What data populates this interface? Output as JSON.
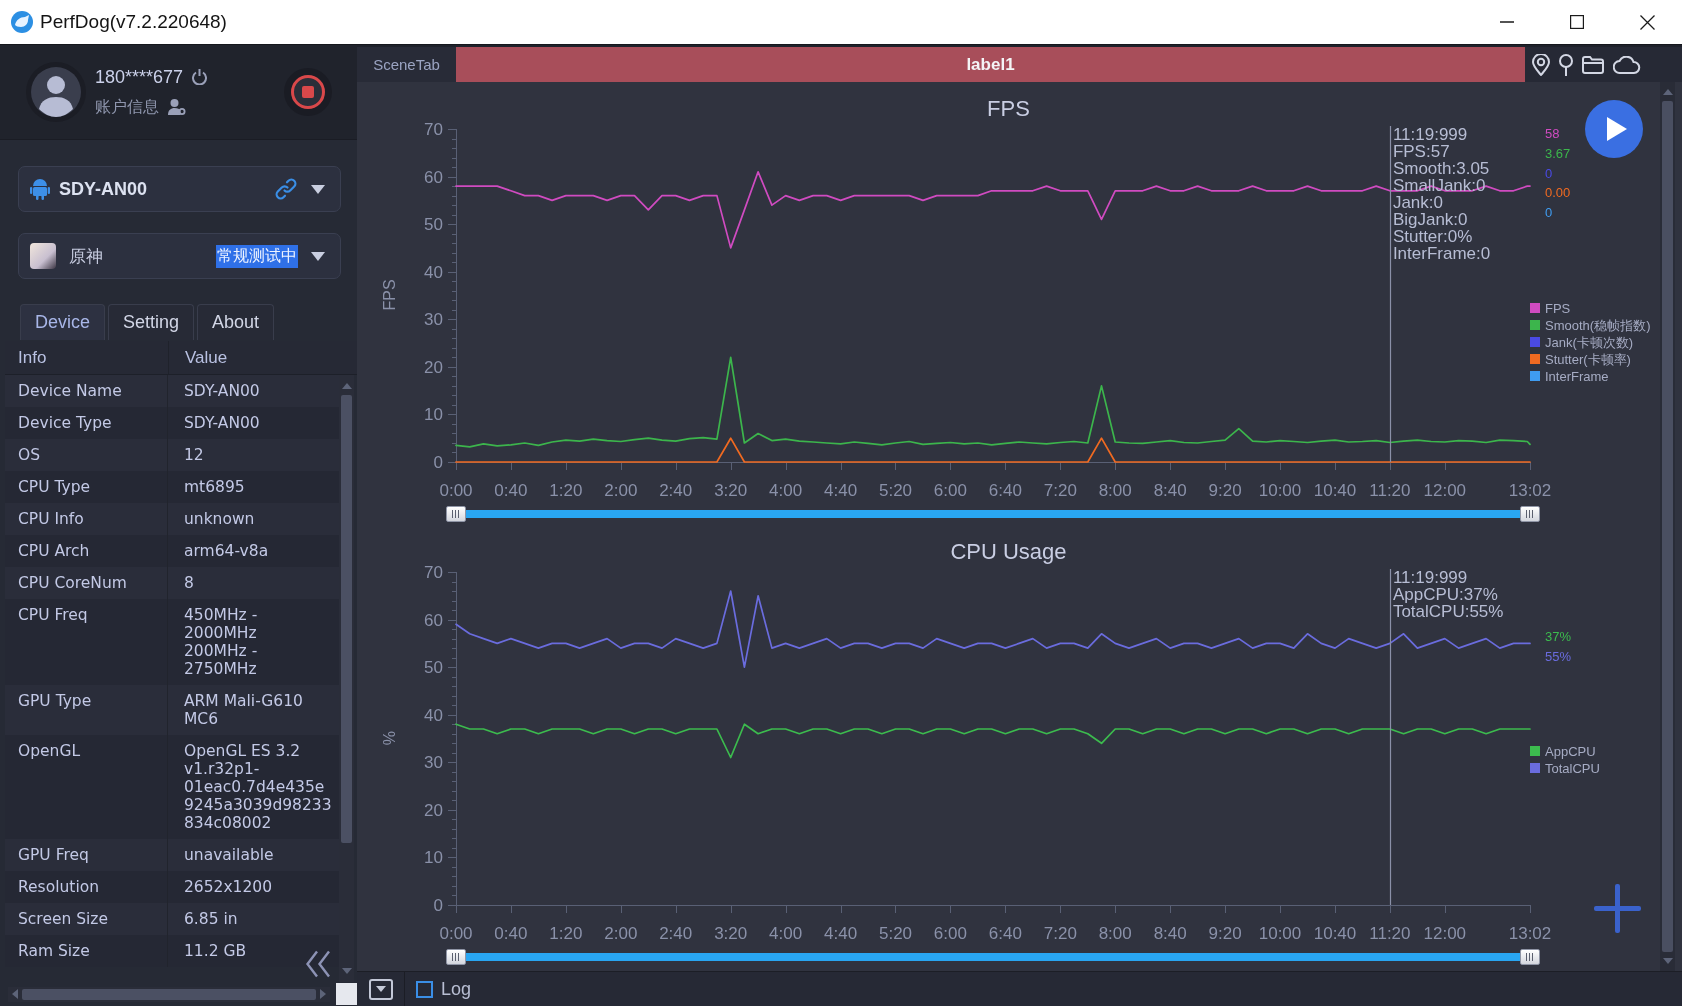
{
  "window": {
    "title": "PerfDog(v7.2.220648)"
  },
  "account": {
    "user": "180****677",
    "info_label": "账户信息",
    "recording": true
  },
  "device_selector": {
    "value": "SDY-AN00"
  },
  "app_selector": {
    "name": "原神",
    "status": "常规测试中",
    "status_highlighted": true
  },
  "tabs": [
    {
      "label": "Device",
      "selected": true
    },
    {
      "label": "Setting",
      "selected": false
    },
    {
      "label": "About",
      "selected": false
    }
  ],
  "info_table": {
    "columns": [
      "Info",
      "Value"
    ],
    "rows": [
      {
        "name": "Device Name",
        "values": [
          "SDY-AN00"
        ]
      },
      {
        "name": "Device Type",
        "values": [
          "SDY-AN00"
        ]
      },
      {
        "name": "OS",
        "values": [
          "12"
        ]
      },
      {
        "name": "CPU Type",
        "values": [
          "mt6895"
        ]
      },
      {
        "name": "CPU Info",
        "values": [
          "unknown"
        ]
      },
      {
        "name": "CPU Arch",
        "values": [
          "arm64-v8a"
        ]
      },
      {
        "name": "CPU CoreNum",
        "values": [
          "8"
        ]
      },
      {
        "name": "CPU Freq",
        "values": [
          "450MHz - 2000MHz",
          "200MHz - 2750MHz"
        ]
      },
      {
        "name": "GPU Type",
        "values": [
          "ARM Mali-G610 MC6"
        ]
      },
      {
        "name": "OpenGL",
        "values": [
          "OpenGL ES 3.2 v1.r32p1-01eac0.7d4e435e9245a3039d98233834c08002"
        ]
      },
      {
        "name": "GPU Freq",
        "values": [
          "unavailable"
        ]
      },
      {
        "name": "Resolution",
        "values": [
          "2652x1200"
        ]
      },
      {
        "name": "Screen Size",
        "values": [
          "6.85 in"
        ]
      },
      {
        "name": "Ram Size",
        "values": [
          "11.2 GB"
        ]
      }
    ]
  },
  "scene_bar": {
    "label": "SceneTab",
    "scenes": [
      {
        "label": "label1",
        "color": "#a84e5a"
      }
    ]
  },
  "charts": [
    {
      "tooltip": [
        "11:19:999",
        "FPS:57",
        "Smooth:3.05",
        "SmallJank:0",
        "Jank:0",
        "BigJank:0",
        "Stutter:0%",
        "InterFrame:0"
      ],
      "latest_values": [
        "58",
        "3.67",
        "0",
        "0.00",
        "0"
      ],
      "zoom_slider": {
        "level": 1
      },
      "chart_data": {
        "type": "line",
        "title": "FPS",
        "ylabel": "FPS",
        "legend": true,
        "xlim": [
          0,
          782
        ],
        "ylim": [
          0,
          70
        ],
        "yticks": [
          0,
          10,
          20,
          30,
          40,
          50,
          60,
          70
        ],
        "xticks": [
          {
            "value": 0,
            "label": "0:00"
          },
          {
            "value": 40,
            "label": "0:40"
          },
          {
            "value": 80,
            "label": "1:20"
          },
          {
            "value": 120,
            "label": "2:00"
          },
          {
            "value": 160,
            "label": "2:40"
          },
          {
            "value": 200,
            "label": "3:20"
          },
          {
            "value": 240,
            "label": "4:00"
          },
          {
            "value": 280,
            "label": "4:40"
          },
          {
            "value": 320,
            "label": "5:20"
          },
          {
            "value": 360,
            "label": "6:00"
          },
          {
            "value": 400,
            "label": "6:40"
          },
          {
            "value": 440,
            "label": "7:20"
          },
          {
            "value": 480,
            "label": "8:00"
          },
          {
            "value": 520,
            "label": "8:40"
          },
          {
            "value": 560,
            "label": "9:20"
          },
          {
            "value": 600,
            "label": "10:00"
          },
          {
            "value": 640,
            "label": "10:40"
          },
          {
            "value": 680,
            "label": "11:20"
          },
          {
            "value": 720,
            "label": "12:00"
          },
          {
            "value": 782,
            "label": "13:02"
          }
        ],
        "ref_lines": [
          {
            "axis": "x",
            "value": 680
          }
        ],
        "x": [
          0,
          10,
          20,
          30,
          40,
          50,
          60,
          70,
          80,
          90,
          100,
          110,
          120,
          130,
          140,
          150,
          160,
          170,
          180,
          190,
          200,
          210,
          220,
          230,
          240,
          250,
          260,
          270,
          280,
          290,
          300,
          310,
          320,
          330,
          340,
          350,
          360,
          370,
          380,
          390,
          400,
          410,
          420,
          430,
          440,
          450,
          460,
          470,
          480,
          490,
          500,
          510,
          520,
          530,
          540,
          550,
          560,
          570,
          580,
          590,
          600,
          610,
          620,
          630,
          640,
          650,
          660,
          670,
          680,
          690,
          700,
          710,
          720,
          730,
          740,
          750,
          760,
          770,
          780,
          782
        ],
        "series": [
          {
            "name": "FPS",
            "color": "#d04bc1",
            "values": [
              58,
              58,
              58,
              58,
              57,
              56,
              56,
              55,
              56,
              56,
              56,
              55,
              56,
              56,
              53,
              56,
              56,
              55,
              56,
              56,
              45,
              53,
              61,
              54,
              56,
              55,
              56,
              56,
              55,
              56,
              56,
              56,
              56,
              56,
              55,
              56,
              56,
              56,
              56,
              57,
              57,
              57,
              57,
              58,
              57,
              57,
              57,
              51,
              57,
              57,
              57,
              58,
              57,
              57,
              58,
              57,
              57,
              57,
              58,
              57,
              57,
              57,
              58,
              57,
              57,
              57,
              57,
              58,
              57,
              57,
              57,
              58,
              57,
              57,
              57,
              58,
              57,
              57,
              58,
              58
            ]
          },
          {
            "name": "Smooth(稳帧指数)",
            "color": "#3cb54c",
            "values": [
              3.5,
              3.2,
              3.8,
              3.4,
              3.6,
              4.0,
              3.5,
              4.2,
              4.6,
              4.4,
              4.8,
              4.5,
              4.3,
              4.7,
              5.0,
              4.6,
              4.4,
              4.9,
              5.1,
              4.8,
              22,
              4.0,
              6.0,
              4.5,
              4.8,
              4.4,
              4.2,
              4.0,
              3.8,
              4.2,
              3.9,
              3.6,
              4.0,
              4.3,
              3.7,
              3.9,
              4.1,
              3.8,
              4.0,
              3.6,
              3.9,
              4.2,
              4.0,
              3.8,
              4.1,
              4.3,
              4.0,
              16,
              4.2,
              4.0,
              3.9,
              4.2,
              4.5,
              4.1,
              4.0,
              4.3,
              4.6,
              7.0,
              4.4,
              4.2,
              4.5,
              4.3,
              4.1,
              4.4,
              4.6,
              4.2,
              4.3,
              4.5,
              4.1,
              4.4,
              4.6,
              4.3,
              4.2,
              4.5,
              4.4,
              4.1,
              4.6,
              4.5,
              4.3,
              3.7
            ]
          },
          {
            "name": "Jank(卡顿次数)",
            "color": "#4a4ae4",
            "values": [
              null,
              null,
              null,
              null,
              null,
              null,
              null,
              null,
              null,
              null,
              null,
              null,
              null,
              null,
              null,
              null,
              null,
              null,
              null,
              null,
              null,
              null,
              null,
              null,
              null,
              null,
              null,
              null,
              null,
              null,
              null,
              null,
              null,
              null,
              null,
              null,
              null,
              null,
              null,
              null,
              null,
              null,
              null,
              null,
              null,
              null,
              null,
              null,
              null,
              null,
              null,
              null,
              null,
              null,
              null,
              null,
              null,
              null,
              null,
              null,
              null,
              null,
              null,
              null,
              null,
              null,
              null,
              null,
              null,
              null,
              null,
              null,
              null,
              null,
              null,
              null,
              null,
              null,
              null,
              null
            ]
          },
          {
            "name": "Stutter(卡顿率)",
            "color": "#f06a21",
            "values": [
              0,
              0,
              0,
              0,
              0,
              0,
              0,
              0,
              0,
              0,
              0,
              0,
              0,
              0,
              0,
              0,
              0,
              0,
              0,
              0,
              5,
              0,
              0,
              0,
              0,
              0,
              0,
              0,
              0,
              0,
              0,
              0,
              0,
              0,
              0,
              0,
              0,
              0,
              0,
              0,
              0,
              0,
              0,
              0,
              0,
              0,
              0,
              5,
              0,
              0,
              0,
              0,
              0,
              0,
              0,
              0,
              0,
              0,
              0,
              0,
              0,
              0,
              0,
              0,
              0,
              0,
              0,
              0,
              0,
              0,
              0,
              0,
              0,
              0,
              0,
              0,
              0,
              0,
              0,
              0
            ]
          },
          {
            "name": "InterFrame",
            "color": "#3f9cf0",
            "values": [
              null,
              null,
              null,
              null,
              null,
              null,
              null,
              null,
              null,
              null,
              null,
              null,
              null,
              null,
              null,
              null,
              null,
              null,
              null,
              null,
              null,
              null,
              null,
              null,
              null,
              null,
              null,
              null,
              null,
              null,
              null,
              null,
              null,
              null,
              null,
              null,
              null,
              null,
              null,
              null,
              null,
              null,
              null,
              null,
              null,
              null,
              null,
              null,
              null,
              null,
              null,
              null,
              null,
              null,
              null,
              null,
              null,
              null,
              null,
              null,
              null,
              null,
              null,
              null,
              null,
              null,
              null,
              null,
              null,
              null,
              null,
              null,
              null,
              null,
              null,
              null,
              null,
              null,
              null,
              null
            ]
          }
        ]
      }
    },
    {
      "tooltip": [
        "11:19:999",
        "AppCPU:37%",
        "TotalCPU:55%"
      ],
      "latest_values": [
        "37%",
        "55%"
      ],
      "zoom_slider": {
        "level": 1
      },
      "chart_data": {
        "type": "line",
        "title": "CPU Usage",
        "ylabel": "%",
        "legend": true,
        "xlim": [
          0,
          782
        ],
        "ylim": [
          0,
          70
        ],
        "yticks": [
          0,
          10,
          20,
          30,
          40,
          50,
          60,
          70
        ],
        "xticks": [
          {
            "value": 0,
            "label": "0:00"
          },
          {
            "value": 40,
            "label": "0:40"
          },
          {
            "value": 80,
            "label": "1:20"
          },
          {
            "value": 120,
            "label": "2:00"
          },
          {
            "value": 160,
            "label": "2:40"
          },
          {
            "value": 200,
            "label": "3:20"
          },
          {
            "value": 240,
            "label": "4:00"
          },
          {
            "value": 280,
            "label": "4:40"
          },
          {
            "value": 320,
            "label": "5:20"
          },
          {
            "value": 360,
            "label": "6:00"
          },
          {
            "value": 400,
            "label": "6:40"
          },
          {
            "value": 440,
            "label": "7:20"
          },
          {
            "value": 480,
            "label": "8:00"
          },
          {
            "value": 520,
            "label": "8:40"
          },
          {
            "value": 560,
            "label": "9:20"
          },
          {
            "value": 600,
            "label": "10:00"
          },
          {
            "value": 640,
            "label": "10:40"
          },
          {
            "value": 680,
            "label": "11:20"
          },
          {
            "value": 720,
            "label": "12:00"
          },
          {
            "value": 782,
            "label": "13:02"
          }
        ],
        "ref_lines": [
          {
            "axis": "x",
            "value": 680
          }
        ],
        "x": [
          0,
          10,
          20,
          30,
          40,
          50,
          60,
          70,
          80,
          90,
          100,
          110,
          120,
          130,
          140,
          150,
          160,
          170,
          180,
          190,
          200,
          210,
          220,
          230,
          240,
          250,
          260,
          270,
          280,
          290,
          300,
          310,
          320,
          330,
          340,
          350,
          360,
          370,
          380,
          390,
          400,
          410,
          420,
          430,
          440,
          450,
          460,
          470,
          480,
          490,
          500,
          510,
          520,
          530,
          540,
          550,
          560,
          570,
          580,
          590,
          600,
          610,
          620,
          630,
          640,
          650,
          660,
          670,
          680,
          690,
          700,
          710,
          720,
          730,
          740,
          750,
          760,
          770,
          780,
          782
        ],
        "series": [
          {
            "name": "AppCPU",
            "color": "#3cbb4e",
            "values": [
              38,
              37,
              37,
              36,
              37,
              37,
              36,
              37,
              37,
              37,
              36,
              37,
              37,
              36,
              37,
              37,
              36,
              37,
              37,
              37,
              31,
              38,
              36,
              37,
              37,
              36,
              37,
              37,
              36,
              37,
              37,
              36,
              37,
              37,
              36,
              37,
              37,
              36,
              37,
              37,
              36,
              37,
              37,
              36,
              37,
              37,
              36,
              34,
              37,
              37,
              36,
              37,
              37,
              36,
              37,
              37,
              36,
              37,
              37,
              36,
              37,
              37,
              36,
              37,
              37,
              36,
              37,
              37,
              37,
              36,
              37,
              37,
              36,
              37,
              37,
              36,
              37,
              37,
              37,
              37
            ]
          },
          {
            "name": "TotalCPU",
            "color": "#6a6cde",
            "values": [
              59,
              57,
              56,
              55,
              56,
              55,
              54,
              55,
              55,
              54,
              55,
              56,
              54,
              55,
              55,
              54,
              56,
              55,
              54,
              55,
              66,
              50,
              65,
              54,
              55,
              54,
              55,
              56,
              54,
              55,
              55,
              54,
              55,
              55,
              54,
              56,
              55,
              54,
              55,
              55,
              54,
              55,
              56,
              54,
              55,
              55,
              54,
              57,
              55,
              54,
              55,
              56,
              54,
              55,
              55,
              54,
              55,
              56,
              54,
              55,
              55,
              54,
              57,
              55,
              54,
              56,
              55,
              54,
              55,
              57,
              54,
              55,
              56,
              54,
              55,
              56,
              54,
              55,
              55,
              55
            ]
          }
        ]
      }
    }
  ],
  "log": {
    "label": "Log",
    "checked": false
  }
}
